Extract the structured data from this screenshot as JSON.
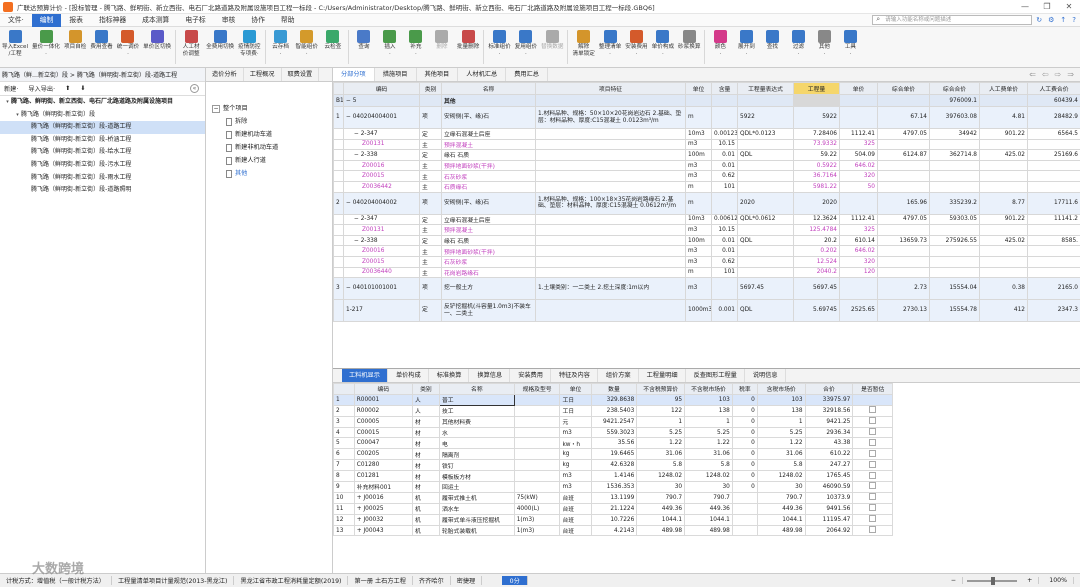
{
  "window": {
    "title": "广联达预算计价 - [投标管理 - 腾飞路、鲜明街、新立西街、电石厂北路道路及附属设施项目工程一标段 - C:/Users/Administrator/Desktop/腾飞路、鲜明街、新立西街、电石厂北路道路及附属设施项目工程一标段.GBQ6]",
    "controls": [
      "—",
      "❐",
      "✕"
    ]
  },
  "menubar": {
    "items": [
      "文件·",
      "编制",
      "报表",
      "指标神器",
      "成本测算",
      "电子标",
      "审核",
      "协作",
      "帮助"
    ],
    "active_index": 1,
    "search_placeholder": "请输入功能名称或问题描述",
    "right_icons": [
      "↻",
      "⚙",
      "↑",
      "?"
    ]
  },
  "ribbon": {
    "buttons": [
      {
        "label": "导入Excel\n/工程",
        "color": "#3a78c8"
      },
      {
        "label": "量价一体化\n·",
        "color": "#4a9a4a"
      },
      {
        "label": "项目自检",
        "color": "#d4952b"
      },
      {
        "label": "费用查看",
        "color": "#3a78c8"
      },
      {
        "label": "统一调价\n·",
        "color": "#d45a2b"
      },
      {
        "label": "单价区切换",
        "color": "#5a5ac8"
      },
      {
        "label": "人工材\n价调整",
        "color": "#c84a4a"
      },
      {
        "label": "全费用切换",
        "color": "#3a78c8"
      },
      {
        "label": "疫情防控\n专项费·",
        "color": "#2b9ad4"
      },
      {
        "label": "云存档\n·",
        "color": "#3a9ad4"
      },
      {
        "label": "智能组价\n·",
        "color": "#d49a2b"
      },
      {
        "label": "云检查",
        "color": "#3aa86a"
      },
      {
        "label": "查询",
        "color": "#4a7ac8"
      },
      {
        "label": "插入\n·",
        "color": "#4a9a4a"
      },
      {
        "label": "补充\n·",
        "color": "#4a9a4a"
      },
      {
        "label": "删除",
        "color": "#aaaaaa",
        "disabled": true
      },
      {
        "label": "批量删除",
        "color": "#c84a4a"
      },
      {
        "label": "标准组价\n·",
        "color": "#3a78c8"
      },
      {
        "label": "复用组价\n·",
        "color": "#3a78c8"
      },
      {
        "label": "替换数据",
        "color": "#aaaaaa",
        "disabled": true
      },
      {
        "label": "解除\n清单锁定",
        "color": "#d4952b"
      },
      {
        "label": "整理清单\n·",
        "color": "#3a78c8"
      },
      {
        "label": "安装费用\n·",
        "color": "#d45a2b"
      },
      {
        "label": "单价构成\n·",
        "color": "#3a78c8"
      },
      {
        "label": "砂浆换算",
        "color": "#888888"
      },
      {
        "label": "颜色\n·",
        "color": "#d43a8a"
      },
      {
        "label": "展开到\n·",
        "color": "#3a78c8"
      },
      {
        "label": "查找",
        "color": "#3a78c8"
      },
      {
        "label": "过滤\n·",
        "color": "#3a78c8"
      },
      {
        "label": "其他\n·",
        "color": "#888888"
      },
      {
        "label": "工具\n·",
        "color": "#3a78c8"
      }
    ]
  },
  "left_panel": {
    "header": "腾飞路（鲜…新立街）段 > 腾飞路（鲜明街-新立街）段-道路工程",
    "toolbar": [
      "新建·",
      "导入导出·",
      "⬆",
      "⬇"
    ],
    "tree": [
      {
        "label": "腾飞路、鲜明街、新立西街、电石厂北路道路及附属设施项目",
        "level": 0,
        "toggle": "▾",
        "bold": true
      },
      {
        "label": "腾飞路（鲜明街-新立街）段",
        "level": 1,
        "toggle": "▾"
      },
      {
        "label": "腾飞路（鲜明街-新立街）段-道路工程",
        "level": 2,
        "selected": true
      },
      {
        "label": "腾飞路（鲜明街-新立街）段-桥涵工程",
        "level": 2
      },
      {
        "label": "腾飞路（鲜明街-新立街）段-给水工程",
        "level": 2
      },
      {
        "label": "腾飞路（鲜明街-新立街）段-污水工程",
        "level": 2
      },
      {
        "label": "腾飞路（鲜明街-新立街）段-雨水工程",
        "level": 2
      },
      {
        "label": "腾飞路（鲜明街-新立街）段-道路照明",
        "level": 2
      }
    ]
  },
  "middle_panel": {
    "tabs": [
      "造价分析",
      "工程概况",
      "取费设置"
    ],
    "tree": [
      {
        "label": "整个项目",
        "type": "folder"
      },
      {
        "label": "拆除",
        "type": "doc"
      },
      {
        "label": "新建机动车道",
        "type": "doc"
      },
      {
        "label": "新建非机动车道",
        "type": "doc"
      },
      {
        "label": "新建人行道",
        "type": "doc"
      },
      {
        "label": "其他",
        "type": "doc",
        "selected": true
      }
    ]
  },
  "main_tabs": {
    "items": [
      "分部分项",
      "措施项目",
      "其他项目",
      "人材机汇总",
      "费用汇总"
    ],
    "active_index": 0,
    "nav": [
      "⇐",
      "⇦",
      "⇨",
      "⇒"
    ]
  },
  "main_grid": {
    "headers": [
      "",
      "编码",
      "类别",
      "名称",
      "项目特征",
      "单位",
      "含量",
      "工程量表达式",
      "工程量",
      "单价",
      "综合单价",
      "综合合价",
      "人工费单价",
      "人工费合价"
    ],
    "rows": [
      {
        "kind": "sec",
        "cells": [
          "B1",
          "− 5",
          "",
          "其他",
          "",
          "",
          "",
          "",
          "",
          "",
          "",
          "976009.1",
          "",
          "60439.4"
        ]
      },
      {
        "kind": "main",
        "cells": [
          "1",
          "− 040204004001",
          "项",
          "安砌侧(平、缘)石",
          "1.材料品种、规格：50×10×20花岗岩边石\n2.基础、垫层：材料品种、厚度:C15混凝土 0.0123m³/m",
          "m",
          "",
          "5922",
          "5922",
          "",
          "67.14",
          "397603.08",
          "4.81",
          "28482.9"
        ]
      },
      {
        "kind": "sub",
        "cells": [
          "",
          "− 2-347",
          "定",
          "立缘石混凝土后座",
          "",
          "10m3",
          "0.00123",
          "QDL*0.0123",
          "7.28406",
          "1112.41",
          "4797.05",
          "34942",
          "901.22",
          "6564.5"
        ]
      },
      {
        "kind": "subp",
        "cells": [
          "",
          "Z00131",
          "主",
          "预拌混凝土",
          "",
          "m3",
          "10.15",
          "",
          "73.9332",
          "325",
          "",
          "",
          "",
          ""
        ]
      },
      {
        "kind": "sub",
        "cells": [
          "",
          "− 2-338",
          "定",
          "缘石 石质",
          "",
          "100m",
          "0.01",
          "QDL",
          "59.22",
          "504.09",
          "6124.87",
          "362714.8",
          "425.02",
          "25169.6"
        ]
      },
      {
        "kind": "subp",
        "cells": [
          "",
          "Z00016",
          "主",
          "预拌地面砂浆(干拌)",
          "",
          "m3",
          "0.01",
          "",
          "0.5922",
          "646.02",
          "",
          "",
          "",
          ""
        ]
      },
      {
        "kind": "subp",
        "cells": [
          "",
          "Z00015",
          "主",
          "石灰砂浆",
          "",
          "m3",
          "0.62",
          "",
          "36.7164",
          "320",
          "",
          "",
          "",
          ""
        ]
      },
      {
        "kind": "subp",
        "cells": [
          "",
          "Z0036442",
          "主",
          "石质缘石",
          "",
          "m",
          "101",
          "",
          "5981.22",
          "50",
          "",
          "",
          "",
          ""
        ]
      },
      {
        "kind": "main",
        "cells": [
          "2",
          "− 040204004002",
          "项",
          "安砌侧(平、缘)石",
          "1.材料品种、规格：100×18×35花岗岩路缘石\n2.基础、垫层：材料品种、厚度:C15混凝土 0.0612m³/m",
          "m",
          "",
          "2020",
          "2020",
          "",
          "165.96",
          "335239.2",
          "8.77",
          "17711.6"
        ]
      },
      {
        "kind": "sub",
        "cells": [
          "",
          "− 2-347",
          "定",
          "立缘石混凝土后座",
          "",
          "10m3",
          "0.00612",
          "QDL*0.0612",
          "12.3624",
          "1112.41",
          "4797.05",
          "59303.05",
          "901.22",
          "11141.2"
        ]
      },
      {
        "kind": "subp",
        "cells": [
          "",
          "Z00131",
          "主",
          "预拌混凝土",
          "",
          "m3",
          "10.15",
          "",
          "125.4784",
          "325",
          "",
          "",
          "",
          ""
        ]
      },
      {
        "kind": "sub",
        "cells": [
          "",
          "− 2-338",
          "定",
          "缘石 石质",
          "",
          "100m",
          "0.01",
          "QDL",
          "20.2",
          "610.14",
          "13659.73",
          "275926.55",
          "425.02",
          "8585."
        ]
      },
      {
        "kind": "subp",
        "cells": [
          "",
          "Z00016",
          "主",
          "预拌地面砂浆(干拌)",
          "",
          "m3",
          "0.01",
          "",
          "0.202",
          "646.02",
          "",
          "",
          "",
          ""
        ]
      },
      {
        "kind": "subp",
        "cells": [
          "",
          "Z00015",
          "主",
          "石灰砂浆",
          "",
          "m3",
          "0.62",
          "",
          "12.524",
          "320",
          "",
          "",
          "",
          ""
        ]
      },
      {
        "kind": "subp",
        "cells": [
          "",
          "Z0036440",
          "主",
          "花岗岩路缘石",
          "",
          "m",
          "101",
          "",
          "2040.2",
          "120",
          "",
          "",
          "",
          ""
        ]
      },
      {
        "kind": "main",
        "cells": [
          "3",
          "− 040101001001",
          "项",
          "挖一般土方",
          "1.土壤类别：一二类土\n2.挖土深度:1m以内",
          "m3",
          "",
          "5697.45",
          "5697.45",
          "",
          "2.73",
          "15554.04",
          "0.38",
          "2165.0"
        ]
      },
      {
        "kind": "main",
        "cells": [
          "",
          "1-217",
          "定",
          "反铲挖掘机(斗容量1.0m3)不装车 一、二类土",
          "",
          "1000m3",
          "0.001",
          "QDL",
          "5.69745",
          "2525.65",
          "2730.13",
          "15554.78",
          "412",
          "2347.3"
        ]
      }
    ]
  },
  "bottom_tabs": {
    "items": [
      "工料机显示",
      "单价构成",
      "标准换算",
      "换算信息",
      "安装费用",
      "特征及内容",
      "组价方案",
      "工程量明细",
      "反查图形工程量",
      "说明信息"
    ],
    "active_index": 0
  },
  "bottom_grid": {
    "headers": [
      "",
      "编码",
      "类别",
      "名称",
      "规格及型号",
      "单位",
      "数量",
      "不含税预算价",
      "不含税市场价",
      "税率",
      "含税市场价",
      "合价",
      "是否暂估"
    ],
    "rows": [
      {
        "sel": true,
        "cells": [
          "1",
          "R00001",
          "人",
          "普工",
          "",
          "工日",
          "329.8638",
          "95",
          "103",
          "0",
          "103",
          "33975.97",
          ""
        ]
      },
      {
        "cells": [
          "2",
          "R00002",
          "人",
          "技工",
          "",
          "工日",
          "238.5403",
          "122",
          "138",
          "0",
          "138",
          "32918.56",
          ""
        ]
      },
      {
        "cells": [
          "3",
          "C00005",
          "材",
          "其他材料费",
          "",
          "元",
          "9421.2547",
          "1",
          "1",
          "0",
          "1",
          "9421.25",
          ""
        ]
      },
      {
        "cells": [
          "4",
          "C00015",
          "材",
          "水",
          "",
          "m3",
          "559.3023",
          "5.25",
          "5.25",
          "0",
          "5.25",
          "2936.34",
          ""
        ]
      },
      {
        "cells": [
          "5",
          "C00047",
          "材",
          "电",
          "",
          "kw・h",
          "35.56",
          "1.22",
          "1.22",
          "0",
          "1.22",
          "43.38",
          ""
        ]
      },
      {
        "cells": [
          "6",
          "C00205",
          "材",
          "隔离剂",
          "",
          "kg",
          "19.6465",
          "31.06",
          "31.06",
          "0",
          "31.06",
          "610.22",
          ""
        ]
      },
      {
        "cells": [
          "7",
          "C01280",
          "材",
          "铁钉",
          "",
          "kg",
          "42.6328",
          "5.8",
          "5.8",
          "0",
          "5.8",
          "247.27",
          ""
        ]
      },
      {
        "cells": [
          "8",
          "C01281",
          "材",
          "模板板方材",
          "",
          "m3",
          "1.4146",
          "1248.02",
          "1248.02",
          "0",
          "1248.02",
          "1765.45",
          ""
        ]
      },
      {
        "cells": [
          "9",
          "补充材料001",
          "材",
          "回运土",
          "",
          "m3",
          "1536.353",
          "30",
          "30",
          "0",
          "30",
          "46090.59",
          ""
        ]
      },
      {
        "cells": [
          "10",
          "+ J00016",
          "机",
          "履带式推土机",
          "75(kW)",
          "台班",
          "13.1199",
          "790.7",
          "790.7",
          "",
          "790.7",
          "10373.9",
          ""
        ]
      },
      {
        "cells": [
          "11",
          "+ J00025",
          "机",
          "洒水车",
          "4000(L)",
          "台班",
          "21.1224",
          "449.36",
          "449.36",
          "",
          "449.36",
          "9491.56",
          ""
        ]
      },
      {
        "cells": [
          "12",
          "+ J00032",
          "机",
          "履带式单斗液压挖掘机",
          "1(m3)",
          "台班",
          "10.7226",
          "1044.1",
          "1044.1",
          "",
          "1044.1",
          "11195.47",
          ""
        ]
      },
      {
        "cells": [
          "13",
          "+ J00043",
          "机",
          "轮胎式装载机",
          "1(m3)",
          "台班",
          "4.2143",
          "489.98",
          "489.98",
          "",
          "489.98",
          "2064.92",
          ""
        ]
      }
    ]
  },
  "statusbar": {
    "items": [
      "计税方式：增值税（一般计税方法）",
      "工程量清单项目计量规范(2013-黑龙江)",
      "黑龙江省市政工程消耗量定额(2019)",
      "第一册 土石方工程",
      "齐齐哈尔",
      "密捷理"
    ],
    "progress": "0分",
    "zoom": "100%"
  },
  "watermark": "大数跨境"
}
